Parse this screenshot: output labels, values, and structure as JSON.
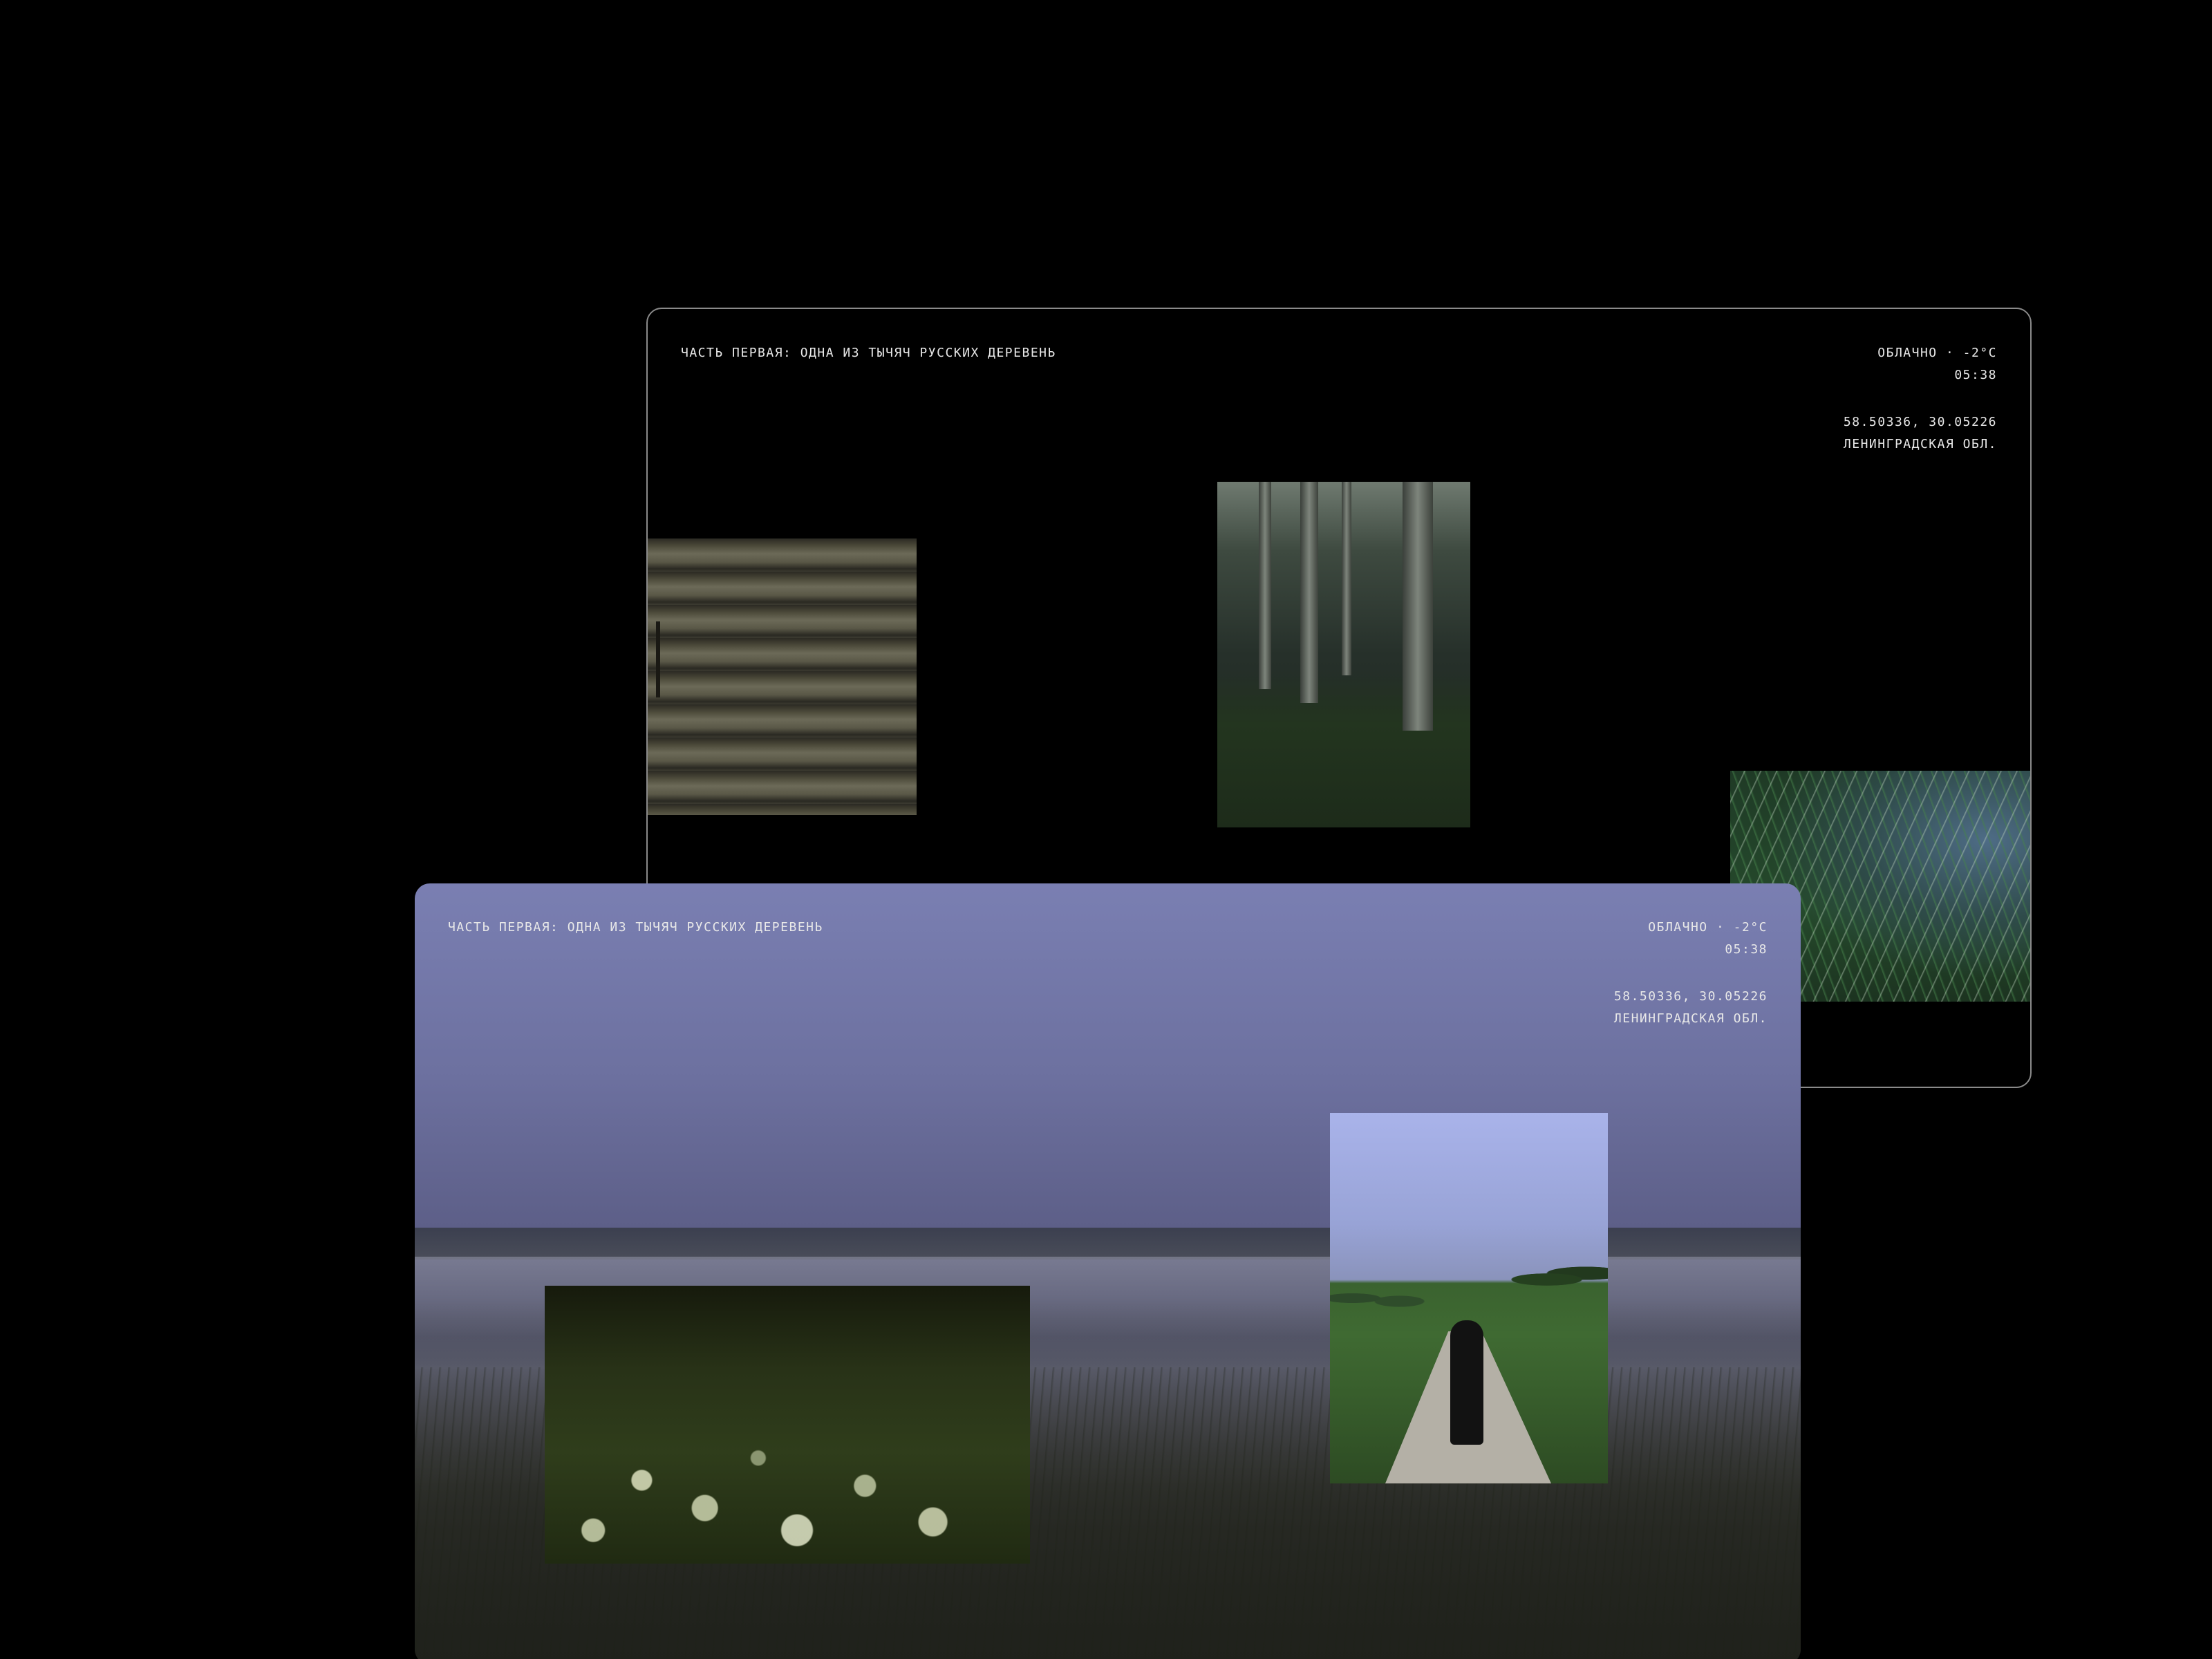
{
  "back_window": {
    "title": "ЧАСТЬ ПЕРВАЯ: ОДНА ИЗ ТЫЧЯЧ РУССКИХ ДЕРЕВЕНЬ",
    "weather": "ОБЛАЧНО · -2°C",
    "time": "05:38",
    "coordinates": "58.50336, 30.05226",
    "region": "ЛЕНИНГРАДСКАЯ ОБЛ."
  },
  "front_window": {
    "title": "ЧАСТЬ ПЕРВАЯ: ОДНА ИЗ ТЫЧЯЧ РУССКИХ ДЕРЕВЕНЬ",
    "weather": "ОБЛАЧНО · -2°C",
    "time": "05:38",
    "coordinates": "58.50336, 30.05226",
    "region": "ЛЕНИНГРАДСКАЯ ОБЛ."
  },
  "colors": {
    "background": "#000000",
    "text": "#e8e8e8",
    "back_window_border": "#8a8a8a",
    "front_window_sky": "#7a7fb2"
  }
}
